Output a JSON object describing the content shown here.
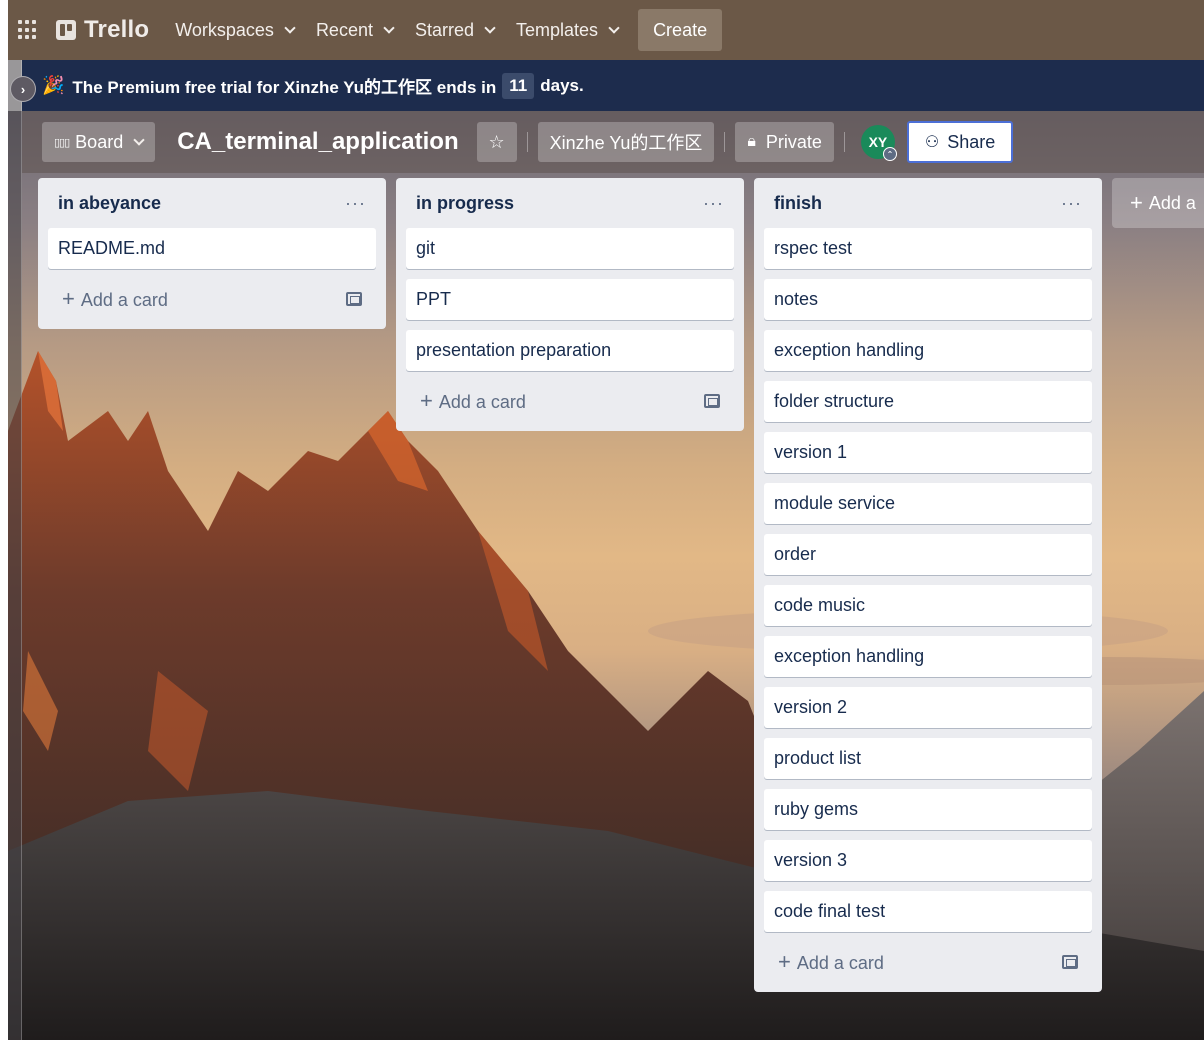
{
  "topnav": {
    "logo": "Trello",
    "items": [
      {
        "label": "Workspaces"
      },
      {
        "label": "Recent"
      },
      {
        "label": "Starred"
      },
      {
        "label": "Templates"
      }
    ],
    "create_label": "Create"
  },
  "banner": {
    "prefix": "The Premium free trial for Xinzhe Yu的工作区 ends in",
    "days": "11",
    "suffix": "days."
  },
  "board": {
    "view_label": "Board",
    "title": "CA_terminal_application",
    "workspace_label": "Xinzhe Yu的工作区",
    "visibility_label": "Private",
    "avatar_initials": "XY",
    "share_label": "Share",
    "add_list_label": "Add a"
  },
  "lists": [
    {
      "title": "in abeyance",
      "cards": [
        "README.md"
      ],
      "add_card_label": "Add a card"
    },
    {
      "title": "in progress",
      "cards": [
        "git",
        "PPT",
        "presentation preparation"
      ],
      "add_card_label": "Add a card"
    },
    {
      "title": "finish",
      "cards": [
        "rspec test",
        "notes",
        "exception handling",
        "folder structure",
        "version 1",
        "module service",
        "order",
        "code music",
        "exception handling",
        "version 2",
        "product list",
        "ruby gems",
        "version 3",
        "code final test"
      ],
      "add_card_label": "Add a card"
    }
  ],
  "icons": {
    "apps": "apps-grid-icon",
    "star": "star-icon",
    "lock": "lock-icon",
    "share": "add-person-icon",
    "menu": "ellipsis-icon",
    "template": "card-template-icon",
    "collapse": "chevron-right-icon"
  },
  "colors": {
    "nav": "#6b5847",
    "banner": "#1d2c4d",
    "list_bg": "#ebecf0",
    "avatar": "#1a8a5a",
    "share_border": "#4c6fd6"
  }
}
